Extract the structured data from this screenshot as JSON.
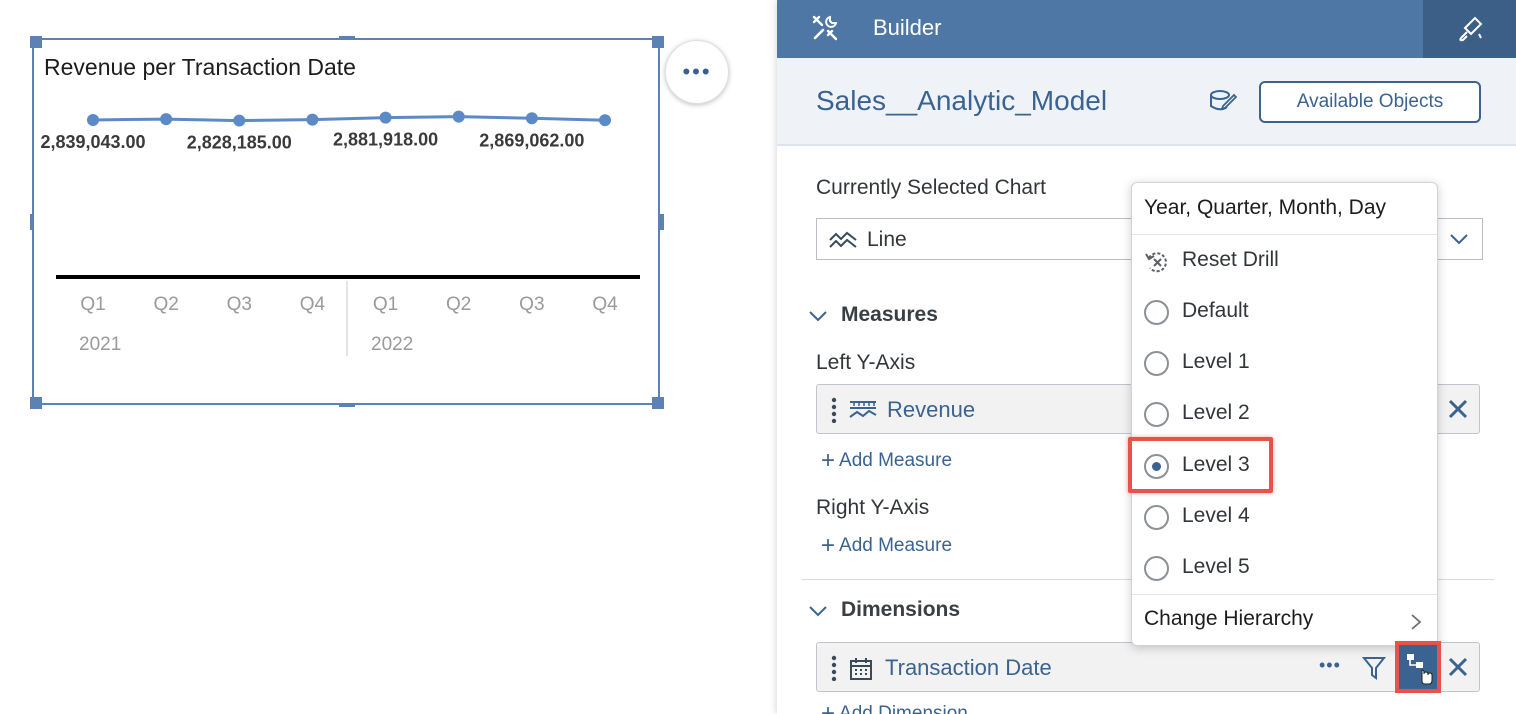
{
  "chart_widget": {
    "title": "Revenue per Transaction Date",
    "more_label": "•••"
  },
  "chart_data": {
    "type": "line",
    "title": "Revenue per Transaction Date",
    "categories": [
      "Q1 2021",
      "Q2 2021",
      "Q3 2021",
      "Q4 2021",
      "Q1 2022",
      "Q2 2022",
      "Q3 2022",
      "Q4 2022"
    ],
    "quarters": [
      "Q1",
      "Q2",
      "Q3",
      "Q4",
      "Q1",
      "Q2",
      "Q3",
      "Q4"
    ],
    "years": [
      "2021",
      "2022"
    ],
    "series": [
      {
        "name": "Revenue",
        "values": [
          2839043.0,
          2855000.0,
          2828185.0,
          2845000.0,
          2881918.0,
          2900000.0,
          2869062.0,
          2835000.0
        ]
      }
    ],
    "data_labels": [
      {
        "index": 0,
        "text": "2,839,043.00"
      },
      {
        "index": 2,
        "text": "2,828,185.00"
      },
      {
        "index": 4,
        "text": "2,881,918.00"
      },
      {
        "index": 6,
        "text": "2,869,062.00"
      }
    ],
    "ylim": [
      0,
      3200000
    ],
    "color": "#5b8ac6",
    "grid": false
  },
  "builder": {
    "header_title": "Builder",
    "model_name": "Sales__Analytic_Model",
    "available_objects_label": "Available Objects",
    "currently_selected_chart_label": "Currently Selected Chart",
    "chart_type_value": "Line",
    "measures_label": "Measures",
    "left_y_axis_label": "Left Y-Axis",
    "revenue_token": "Revenue",
    "add_measure_label": "Add Measure",
    "right_y_axis_label": "Right Y-Axis",
    "dimensions_label": "Dimensions",
    "transaction_date_token": "Transaction Date",
    "token_more": "•••",
    "add_dimension_label": "Add Dimension"
  },
  "drill_menu": {
    "title": "Year, Quarter, Month, Day",
    "reset_label": "Reset Drill",
    "levels": [
      "Default",
      "Level 1",
      "Level 2",
      "Level 3",
      "Level 4",
      "Level 5"
    ],
    "selected_level": "Level 3",
    "change_hierarchy_label": "Change Hierarchy"
  },
  "colors": {
    "header": "#4e77a5",
    "accent": "#3a6391",
    "highlight": "#e8524a"
  }
}
